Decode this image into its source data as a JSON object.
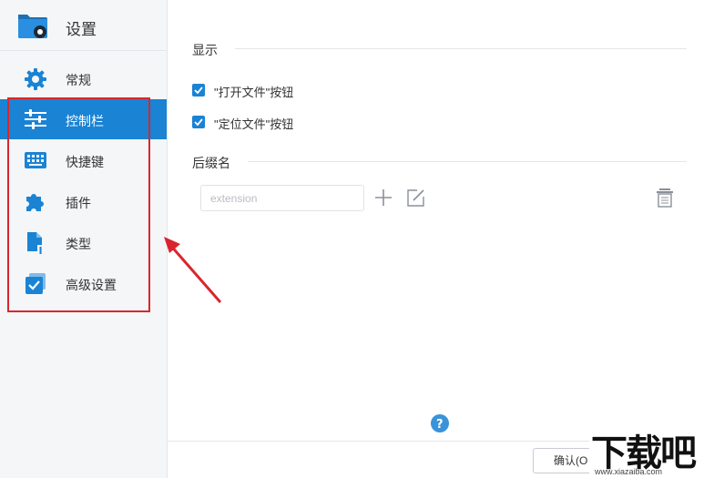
{
  "app": {
    "title": "设置"
  },
  "sidebar": {
    "items": [
      {
        "label": "常规",
        "icon": "gear-icon"
      },
      {
        "label": "控制栏",
        "icon": "sliders-icon",
        "active": true
      },
      {
        "label": "快捷键",
        "icon": "keyboard-icon"
      },
      {
        "label": "插件",
        "icon": "puzzle-icon"
      },
      {
        "label": "类型",
        "icon": "file-type-icon"
      },
      {
        "label": "高级设置",
        "icon": "checkbox-icon"
      }
    ]
  },
  "main": {
    "display_section": {
      "title": "显示",
      "options": [
        {
          "label": "\"打开文件\"按钮",
          "checked": true
        },
        {
          "label": "\"定位文件\"按钮",
          "checked": true
        }
      ]
    },
    "suffix_section": {
      "title": "后缀名",
      "input_placeholder": "extension",
      "input_value": ""
    }
  },
  "footer": {
    "ok_label": "确认(O"
  },
  "watermark": {
    "logo": "下载吧",
    "url": "www.xiazaiba.com"
  },
  "colors": {
    "accent": "#1a83d4",
    "sidebar_bg": "#f4f6f8",
    "annotation": "#d9262c"
  }
}
